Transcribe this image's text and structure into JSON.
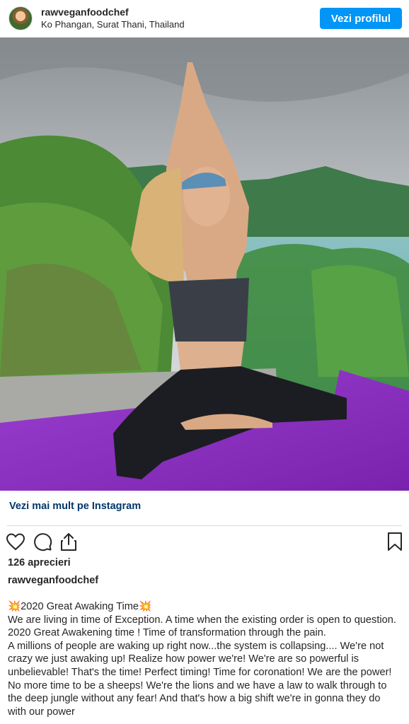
{
  "header": {
    "username": "rawveganfoodchef",
    "location": "Ko Phangan, Surat Thani, Thailand",
    "profile_button": "Vezi profilul"
  },
  "photo": {
    "icon": "yoga-photo"
  },
  "more_link": "Vezi mai mult pe Instagram",
  "actions": {
    "like_icon": "heart-icon",
    "comment_icon": "comment-icon",
    "share_icon": "share-icon",
    "save_icon": "bookmark-icon"
  },
  "likes": "126 aprecieri",
  "caption_user": "rawveganfoodchef",
  "caption": {
    "title_emoji": "💥",
    "title": "2020 Great Awaking Time",
    "lines": [
      "We are living in time of Exception. A time when the existing order is open to question. 2020 Great Awakening time ! Time of transformation through the pain.",
      "A millions of people are waking up right now...the system is collapsing.... We're not crazy we just awaking up! Realize how power we're! We're are so powerful is unbelievable!  That's the time! Perfect timing! Time for coronation!  We are the power! No more time to be a sheeps! We're the lions and we have a law to walk through to the deep jungle without any fear! And that's how a big shift we're in gonna they do with our power"
    ]
  },
  "colors": {
    "accent": "#0095f6",
    "link": "#00376b",
    "mat": "#8e2fc0"
  }
}
